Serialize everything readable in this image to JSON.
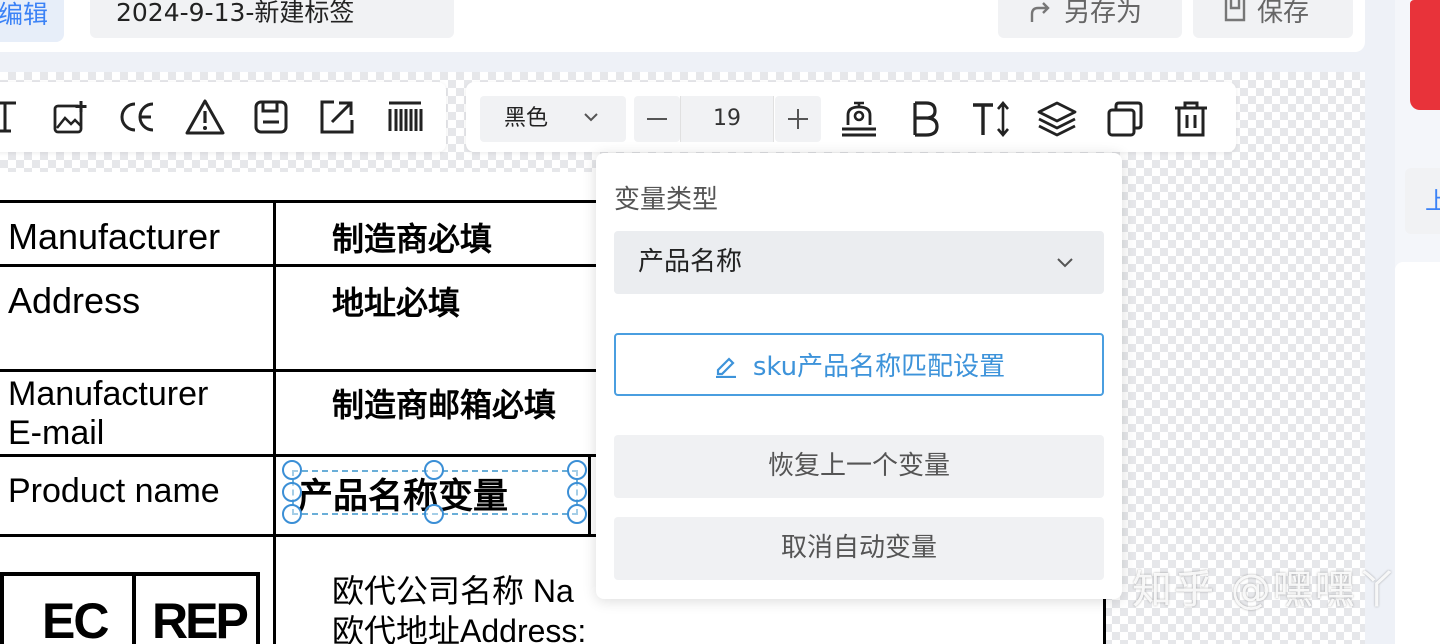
{
  "header": {
    "edit_label": "编辑",
    "doc_title": "2024-9-13-新建标签",
    "save_as_label": "另存为",
    "save_label": "保存"
  },
  "toolbar": {
    "left_tools": [
      "text-tool-icon",
      "add-image-icon",
      "ce-mark-icon",
      "warning-triangle-icon",
      "document-icon",
      "export-icon",
      "barcode-icon"
    ],
    "color_value": "黑色",
    "font_size": "19",
    "right_tools": [
      "stamp-icon",
      "bold-icon",
      "text-height-icon",
      "layers-icon",
      "duplicate-icon",
      "delete-icon"
    ]
  },
  "label_table": {
    "rows": [
      {
        "key": "Manufacturer",
        "value": "制造商必填"
      },
      {
        "key": "Address",
        "value": "地址必填"
      },
      {
        "key_line1": "Manufacturer",
        "key_line2": "E-mail",
        "value": "制造商邮箱必填"
      },
      {
        "key": "Product name",
        "value": "产品名称变量"
      }
    ],
    "ec_rep": {
      "ec": "EC",
      "rep": "REP",
      "line1": "欧代公司名称 Na",
      "line2": "欧代地址Address:"
    }
  },
  "variable_popup": {
    "title": "变量类型",
    "selected_type": "产品名称",
    "sku_button": "sku产品名称匹配设置",
    "restore_button": "恢复上一个变量",
    "cancel_button": "取消自动变量"
  },
  "watermark": "知乎 @嘿嘿丫",
  "side_button_text": "上",
  "colors": {
    "accent": "#3b82f6",
    "selection": "#3b8fd6",
    "sticker_red": "#e8333a"
  }
}
